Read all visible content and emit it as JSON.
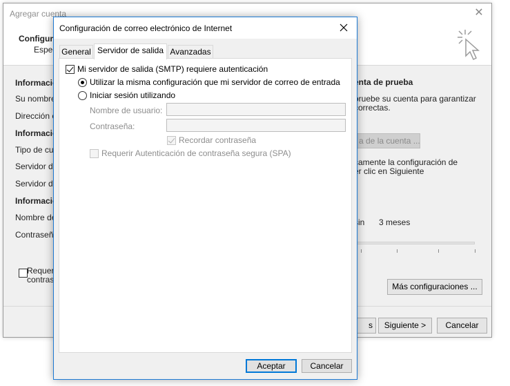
{
  "background_window": {
    "title": "Agregar cuenta",
    "header_title": "Configura",
    "header_subtitle": "Espec",
    "left_labels": [
      {
        "text": "Informació",
        "bold": true
      },
      {
        "text": "Su nombre",
        "bold": false
      },
      {
        "text": "Dirección c",
        "bold": false
      },
      {
        "text": "Informació",
        "bold": true
      },
      {
        "text": "Tipo de cue",
        "bold": false
      },
      {
        "text": "Servidor de",
        "bold": false
      },
      {
        "text": "Servidor de",
        "bold": false
      },
      {
        "text": "Informació",
        "bold": true
      },
      {
        "text": "Nombre de",
        "bold": false
      },
      {
        "text": "Contraseña",
        "bold": false
      }
    ],
    "checkbox_label_line1": "Requeri",
    "checkbox_label_line2": "contras",
    "right_panel": {
      "heading": "enta de prueba",
      "line1": "pruebe su cuenta para garantizar",
      "line2": "correctas.",
      "test_button": "a de la cuenta ...",
      "auto_line1": "camente la configuración de",
      "auto_line2": "er clic en Siguiente",
      "sync_prefix": "sin",
      "sync_value": "3 meses"
    },
    "more_settings_button": "Más configuraciones ...",
    "back_button": "s",
    "next_button": "Siguiente >",
    "cancel_button": "Cancelar"
  },
  "dialog": {
    "title": "Configuración de correo electrónico de Internet",
    "tabs": [
      {
        "label": "General",
        "active": false
      },
      {
        "label": "Servidor de salida",
        "active": true
      },
      {
        "label": "Avanzadas",
        "active": false
      }
    ],
    "smtp_auth_checkbox": {
      "label": "Mi servidor de salida (SMTP) requiere autenticación",
      "checked": true
    },
    "radio_same_settings": {
      "label": "Utilizar la misma configuración que mi servidor de correo de entrada",
      "checked": true
    },
    "radio_login_with": {
      "label": "Iniciar sesión utilizando",
      "checked": false
    },
    "username_label": "Nombre de usuario:",
    "username_value": "",
    "password_label": "Contraseña:",
    "password_value": "",
    "remember_password": {
      "label": "Recordar contraseña",
      "checked": true
    },
    "spa_checkbox": {
      "label": "Requerir Autenticación de contraseña segura (SPA)",
      "checked": false
    },
    "ok_button": "Aceptar",
    "cancel_button": "Cancelar"
  },
  "icons": {
    "dialog_close": "close-icon",
    "background_close": "close-icon",
    "header_icon": "cursor-click-icon"
  },
  "colors": {
    "accent_border": "#1c79d3",
    "default_button_border": "#0078d7",
    "dialog_background": "#f0f0f0"
  }
}
